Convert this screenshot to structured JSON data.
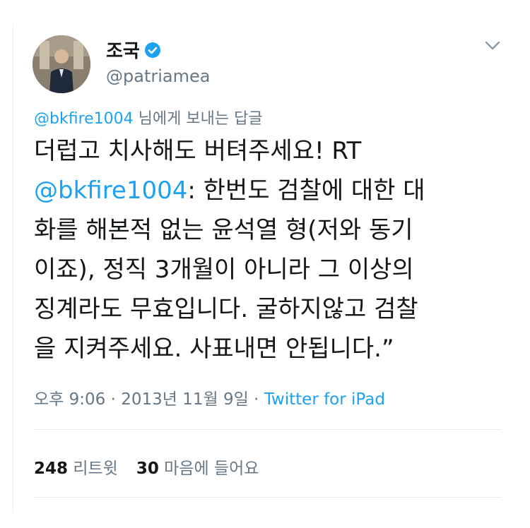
{
  "tweet": {
    "author": {
      "display_name": "조국",
      "handle": "@patriamea",
      "verified": true,
      "avatar_icon": "profile-photo"
    },
    "reply_to": {
      "mention": "@bkfire1004",
      "suffix": " 님에게 보내는 답글"
    },
    "body": {
      "line1": "더럽고 치사해도 버텨주세요! RT",
      "line2_mention": "@bkfire1004",
      "line2_rest": ": 한번도 검찰에 대한 대",
      "line3": "화를 해본적 없는 윤석열 형(저와 동기",
      "line4": "이죠), 정직 3개월이 아니라 그 이상의",
      "line5": "징계라도 무효입니다. 굴하지않고 검찰",
      "line6": "을 지켜주세요. 사표내면 안됩니다.”"
    },
    "meta": {
      "time_date": "오후 9:06 · 2013년 11월 9일 · ",
      "source": "Twitter for iPad"
    },
    "stats": {
      "retweets_count": "248",
      "retweets_label": " 리트윗",
      "likes_count": "30",
      "likes_label": " 마음에 들어요"
    },
    "menu_icon": "chevron-down-icon"
  },
  "colors": {
    "link": "#1da1f2",
    "secondary_text": "#657786",
    "primary_text": "#14171a",
    "divider": "#e6ecf0"
  }
}
